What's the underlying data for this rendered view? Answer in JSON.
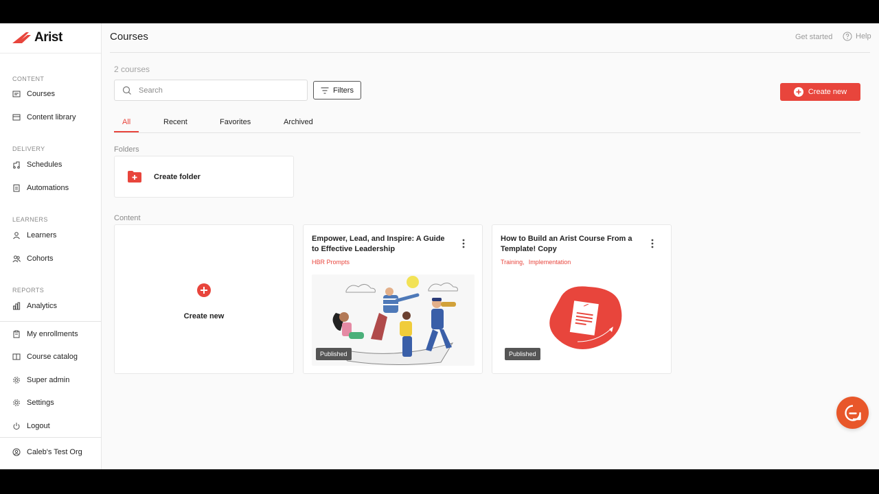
{
  "app": {
    "brand": "Arist",
    "colors": {
      "accent": "#e8453c",
      "chat": "#e8572a"
    }
  },
  "sidebar": {
    "sections": {
      "content": "CONTENT",
      "delivery": "DELIVERY",
      "learners": "LEARNERS",
      "reports": "REPORTS"
    },
    "items": {
      "courses": {
        "label": "Courses",
        "icon": "courses-icon"
      },
      "content_library": {
        "label": "Content library",
        "icon": "library-icon"
      },
      "schedules": {
        "label": "Schedules",
        "icon": "schedule-icon"
      },
      "automations": {
        "label": "Automations",
        "icon": "automation-icon"
      },
      "learners": {
        "label": "Learners",
        "icon": "user-icon"
      },
      "cohorts": {
        "label": "Cohorts",
        "icon": "users-icon"
      },
      "analytics": {
        "label": "Analytics",
        "icon": "chart-icon"
      },
      "my_enrollments": {
        "label": "My enrollments",
        "icon": "clipboard-icon"
      },
      "course_catalog": {
        "label": "Course catalog",
        "icon": "book-icon"
      },
      "super_admin": {
        "label": "Super admin",
        "icon": "gear-icon"
      },
      "settings": {
        "label": "Settings",
        "icon": "gear-icon"
      },
      "logout": {
        "label": "Logout",
        "icon": "power-icon"
      }
    },
    "org": {
      "label": "Caleb's Test Org",
      "icon": "user-circle-icon"
    }
  },
  "header": {
    "title": "Courses",
    "get_started": "Get started",
    "help": "Help"
  },
  "main": {
    "course_count": "2 courses",
    "search": {
      "placeholder": "Search",
      "value": ""
    },
    "filters_label": "Filters",
    "create_new_label": "Create new",
    "tabs": [
      {
        "label": "All",
        "active": true
      },
      {
        "label": "Recent",
        "active": false
      },
      {
        "label": "Favorites",
        "active": false
      },
      {
        "label": "Archived",
        "active": false
      }
    ],
    "folders_label": "Folders",
    "create_folder_label": "Create folder",
    "content_label": "Content",
    "create_card_label": "Create new",
    "courses": [
      {
        "title": "Empower, Lead, and Inspire: A Guide to Effective Leadership",
        "tags": [
          "HBR Prompts"
        ],
        "status": "Published"
      },
      {
        "title": "How to Build an Arist Course From a Template! Copy",
        "tags": [
          "Training,",
          "Implementation"
        ],
        "status": "Published"
      }
    ]
  },
  "chat": {
    "icon": "chat-icon"
  }
}
